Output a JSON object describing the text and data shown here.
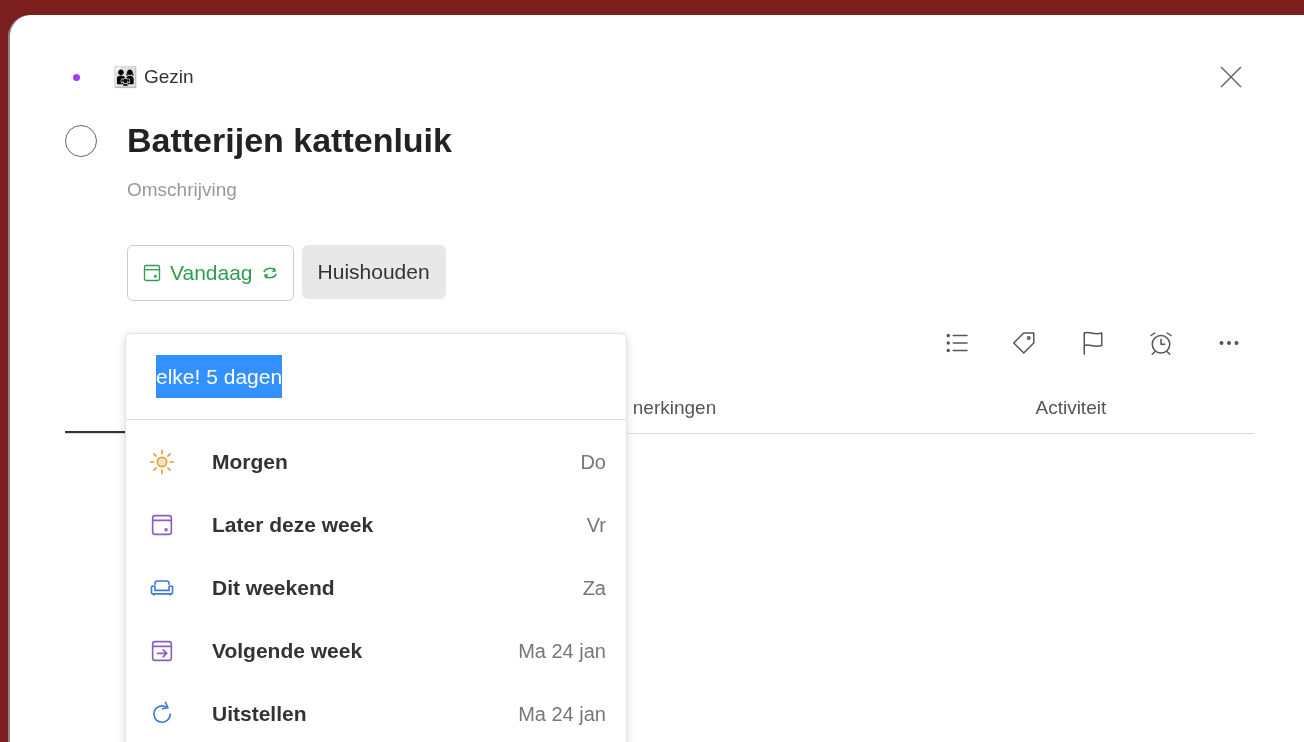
{
  "project": {
    "name": "Gezin",
    "emoji": "👨‍👩‍👧",
    "color": "#a23de8"
  },
  "task": {
    "title": "Batterijen kattenluik",
    "completed": false,
    "description_placeholder": "Omschrijving"
  },
  "chips": [
    {
      "kind": "date",
      "label": "Vandaag",
      "recurring": true
    },
    {
      "kind": "section",
      "label": "Huishouden"
    }
  ],
  "date_picker": {
    "input": "elke! 5 dagen",
    "text_selected": true,
    "options": [
      {
        "kind": "sun",
        "label": "Morgen",
        "day": "Do"
      },
      {
        "kind": "calendar",
        "label": "Later deze week",
        "day": "Vr"
      },
      {
        "kind": "couch",
        "label": "Dit weekend",
        "day": "Za"
      },
      {
        "kind": "arrow",
        "label": "Volgende week",
        "day": "Ma 24 jan"
      },
      {
        "kind": "postpone",
        "label": "Uitstellen",
        "day": "Ma 24 jan"
      }
    ]
  },
  "toolbar": [
    {
      "kind": "subtasks"
    },
    {
      "kind": "labels"
    },
    {
      "kind": "priority"
    },
    {
      "kind": "reminders"
    },
    {
      "kind": "more"
    }
  ],
  "tabs": [
    {
      "selected": true
    },
    {
      "label": "nerkingen",
      "selected": false
    },
    {
      "label": "Activiteit",
      "selected": false
    }
  ]
}
